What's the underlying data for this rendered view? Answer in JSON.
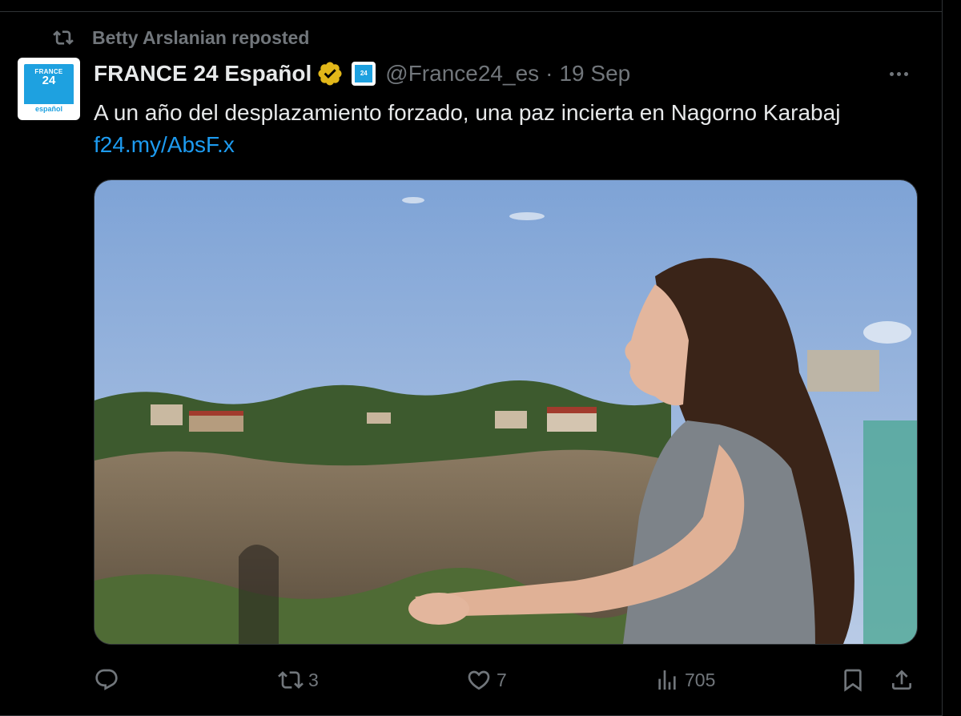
{
  "repost": {
    "label": "Betty Arslanian reposted"
  },
  "author": {
    "name": "FRANCE 24 Español",
    "handle": "@France24_es",
    "separator": "·",
    "date": "19 Sep",
    "avatar_text": {
      "line1": "FRANCE",
      "line2": "24",
      "line3": "español"
    },
    "affiliate_badge_text": "24"
  },
  "tweet": {
    "text": "A un año del desplazamiento forzado, una paz incierta en Nagorno Karabaj",
    "link": "f24.my/AbsF.x"
  },
  "actions": {
    "reply_count": "",
    "repost_count": "3",
    "like_count": "7",
    "views_count": "705"
  },
  "colors": {
    "background": "#000000",
    "text": "#e7e9ea",
    "muted": "#71767b",
    "link": "#1d9bf0",
    "verified_gold": "#e2b719",
    "brand": "#1ea1e0"
  },
  "icons": [
    "repost-icon",
    "verified-badge-icon",
    "more-icon",
    "reply-icon",
    "retweet-icon",
    "like-icon",
    "views-icon",
    "bookmark-icon",
    "share-icon"
  ]
}
